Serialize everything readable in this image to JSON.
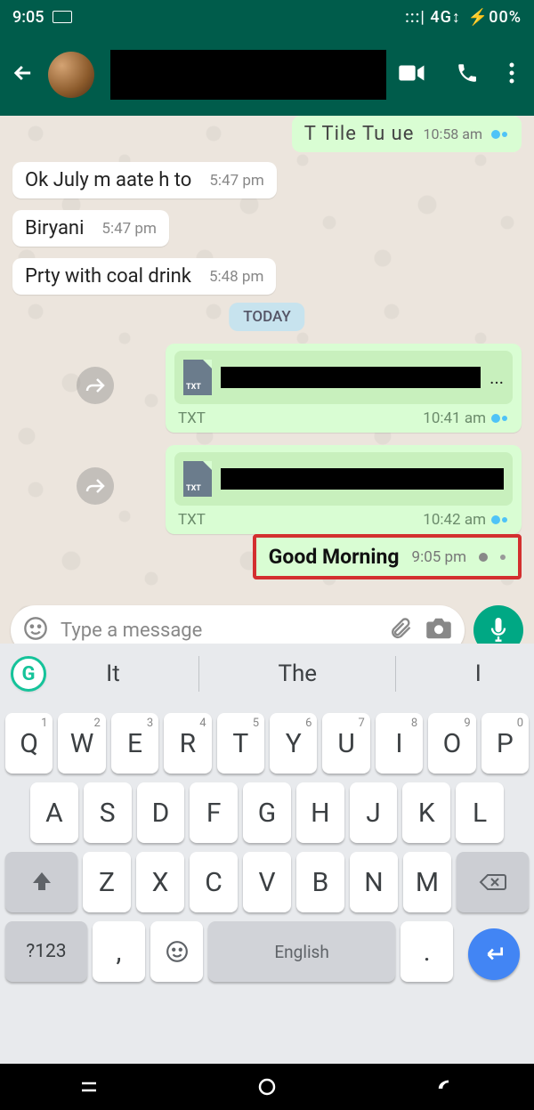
{
  "status": {
    "time": "9:05",
    "network": ":::| 4G↕",
    "battery": "⚡00%"
  },
  "header": {
    "contact_name": ""
  },
  "chat": {
    "prev_msg": {
      "text": "T Tile Tu ue",
      "time": "10:58 am"
    },
    "incoming": [
      {
        "text": "Ok July m aate h to",
        "time": "5:47 pm"
      },
      {
        "text": "Biryani",
        "time": "5:47 pm"
      },
      {
        "text": "Prty with coal drink",
        "time": "5:48 pm"
      }
    ],
    "date_sep": "TODAY",
    "docs": [
      {
        "type": "TXT",
        "time": "10:41 am",
        "ellipsis": "..."
      },
      {
        "type": "TXT",
        "time": "10:42 am",
        "ellipsis": ""
      }
    ],
    "highlighted": {
      "text": "Good Morning",
      "time": "9:05 pm"
    }
  },
  "input": {
    "placeholder": "Type a message"
  },
  "keyboard": {
    "suggestions": [
      "It",
      "The",
      "I"
    ],
    "row1": [
      {
        "k": "Q",
        "h": "1"
      },
      {
        "k": "W",
        "h": "2"
      },
      {
        "k": "E",
        "h": "3"
      },
      {
        "k": "R",
        "h": "4"
      },
      {
        "k": "T",
        "h": "5"
      },
      {
        "k": "Y",
        "h": "6"
      },
      {
        "k": "U",
        "h": "7"
      },
      {
        "k": "I",
        "h": "8"
      },
      {
        "k": "O",
        "h": "9"
      },
      {
        "k": "P",
        "h": "0"
      }
    ],
    "row2": [
      "A",
      "S",
      "D",
      "F",
      "G",
      "H",
      "J",
      "K",
      "L"
    ],
    "row3": [
      "Z",
      "X",
      "C",
      "V",
      "B",
      "N",
      "M"
    ],
    "nums_label": "?123",
    "space_label": "English",
    "comma": ",",
    "period": "."
  }
}
